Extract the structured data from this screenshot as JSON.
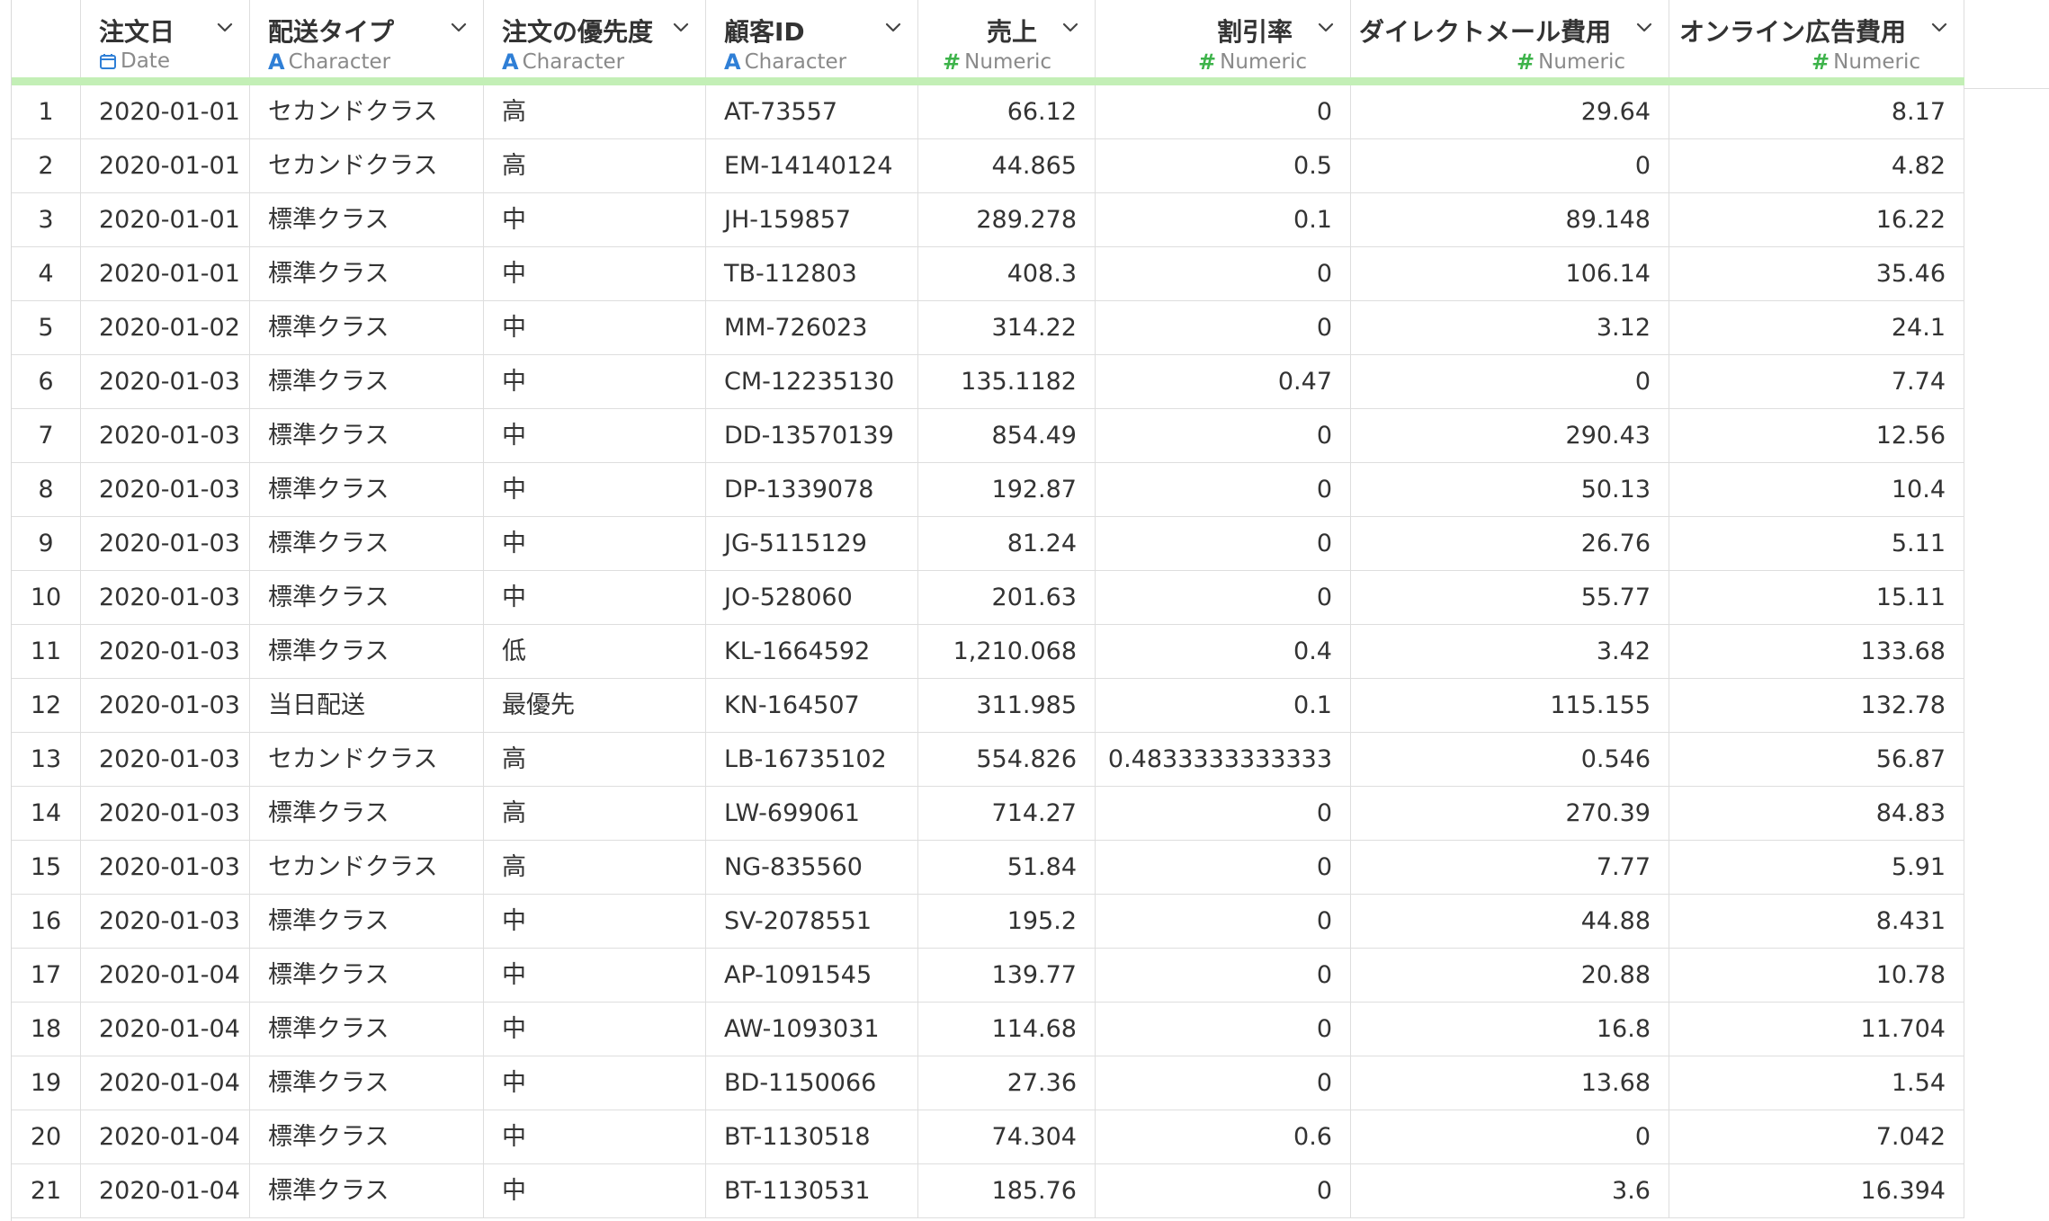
{
  "columns": [
    {
      "name": "",
      "type": ""
    },
    {
      "name": "注文日",
      "type": "Date",
      "icon": "calendar-icon"
    },
    {
      "name": "配送タイプ",
      "type": "Character",
      "icon": "character-type-icon"
    },
    {
      "name": "注文の優先度",
      "type": "Character",
      "icon": "character-type-icon"
    },
    {
      "name": "顧客ID",
      "type": "Character",
      "icon": "character-type-icon"
    },
    {
      "name": "売上",
      "type": "Numeric",
      "icon": "numeric-type-icon"
    },
    {
      "name": "割引率",
      "type": "Numeric",
      "icon": "numeric-type-icon"
    },
    {
      "name": "ダイレクトメール費用",
      "type": "Numeric",
      "icon": "numeric-type-icon"
    },
    {
      "name": "オンライン広告費用",
      "type": "Numeric",
      "icon": "numeric-type-icon"
    }
  ],
  "type_glyphs": {
    "character": "A",
    "numeric": "#"
  },
  "colors": {
    "accent_bar": "#c3efb6",
    "character_icon": "#2f7fd6",
    "numeric_icon": "#3db34a",
    "date_icon": "#2f7fd6"
  },
  "rows": [
    [
      "1",
      "2020-01-01",
      "セカンドクラス",
      "高",
      "AT-73557",
      "66.12",
      "0",
      "29.64",
      "8.17"
    ],
    [
      "2",
      "2020-01-01",
      "セカンドクラス",
      "高",
      "EM-14140124",
      "44.865",
      "0.5",
      "0",
      "4.82"
    ],
    [
      "3",
      "2020-01-01",
      "標準クラス",
      "中",
      "JH-159857",
      "289.278",
      "0.1",
      "89.148",
      "16.22"
    ],
    [
      "4",
      "2020-01-01",
      "標準クラス",
      "中",
      "TB-112803",
      "408.3",
      "0",
      "106.14",
      "35.46"
    ],
    [
      "5",
      "2020-01-02",
      "標準クラス",
      "中",
      "MM-726023",
      "314.22",
      "0",
      "3.12",
      "24.1"
    ],
    [
      "6",
      "2020-01-03",
      "標準クラス",
      "中",
      "CM-12235130",
      "135.1182",
      "0.47",
      "0",
      "7.74"
    ],
    [
      "7",
      "2020-01-03",
      "標準クラス",
      "中",
      "DD-13570139",
      "854.49",
      "0",
      "290.43",
      "12.56"
    ],
    [
      "8",
      "2020-01-03",
      "標準クラス",
      "中",
      "DP-1339078",
      "192.87",
      "0",
      "50.13",
      "10.4"
    ],
    [
      "9",
      "2020-01-03",
      "標準クラス",
      "中",
      "JG-5115129",
      "81.24",
      "0",
      "26.76",
      "5.11"
    ],
    [
      "10",
      "2020-01-03",
      "標準クラス",
      "中",
      "JO-528060",
      "201.63",
      "0",
      "55.77",
      "15.11"
    ],
    [
      "11",
      "2020-01-03",
      "標準クラス",
      "低",
      "KL-1664592",
      "1,210.068",
      "0.4",
      "3.42",
      "133.68"
    ],
    [
      "12",
      "2020-01-03",
      "当日配送",
      "最優先",
      "KN-164507",
      "311.985",
      "0.1",
      "115.155",
      "132.78"
    ],
    [
      "13",
      "2020-01-03",
      "セカンドクラス",
      "高",
      "LB-16735102",
      "554.826",
      "0.4833333333333",
      "0.546",
      "56.87"
    ],
    [
      "14",
      "2020-01-03",
      "標準クラス",
      "高",
      "LW-699061",
      "714.27",
      "0",
      "270.39",
      "84.83"
    ],
    [
      "15",
      "2020-01-03",
      "セカンドクラス",
      "高",
      "NG-835560",
      "51.84",
      "0",
      "7.77",
      "5.91"
    ],
    [
      "16",
      "2020-01-03",
      "標準クラス",
      "中",
      "SV-2078551",
      "195.2",
      "0",
      "44.88",
      "8.431"
    ],
    [
      "17",
      "2020-01-04",
      "標準クラス",
      "中",
      "AP-1091545",
      "139.77",
      "0",
      "20.88",
      "10.78"
    ],
    [
      "18",
      "2020-01-04",
      "標準クラス",
      "中",
      "AW-1093031",
      "114.68",
      "0",
      "16.8",
      "11.704"
    ],
    [
      "19",
      "2020-01-04",
      "標準クラス",
      "中",
      "BD-1150066",
      "27.36",
      "0",
      "13.68",
      "1.54"
    ],
    [
      "20",
      "2020-01-04",
      "標準クラス",
      "中",
      "BT-1130518",
      "74.304",
      "0.6",
      "0",
      "7.042"
    ],
    [
      "21",
      "2020-01-04",
      "標準クラス",
      "中",
      "BT-1130531",
      "185.76",
      "0",
      "3.6",
      "16.394"
    ]
  ]
}
